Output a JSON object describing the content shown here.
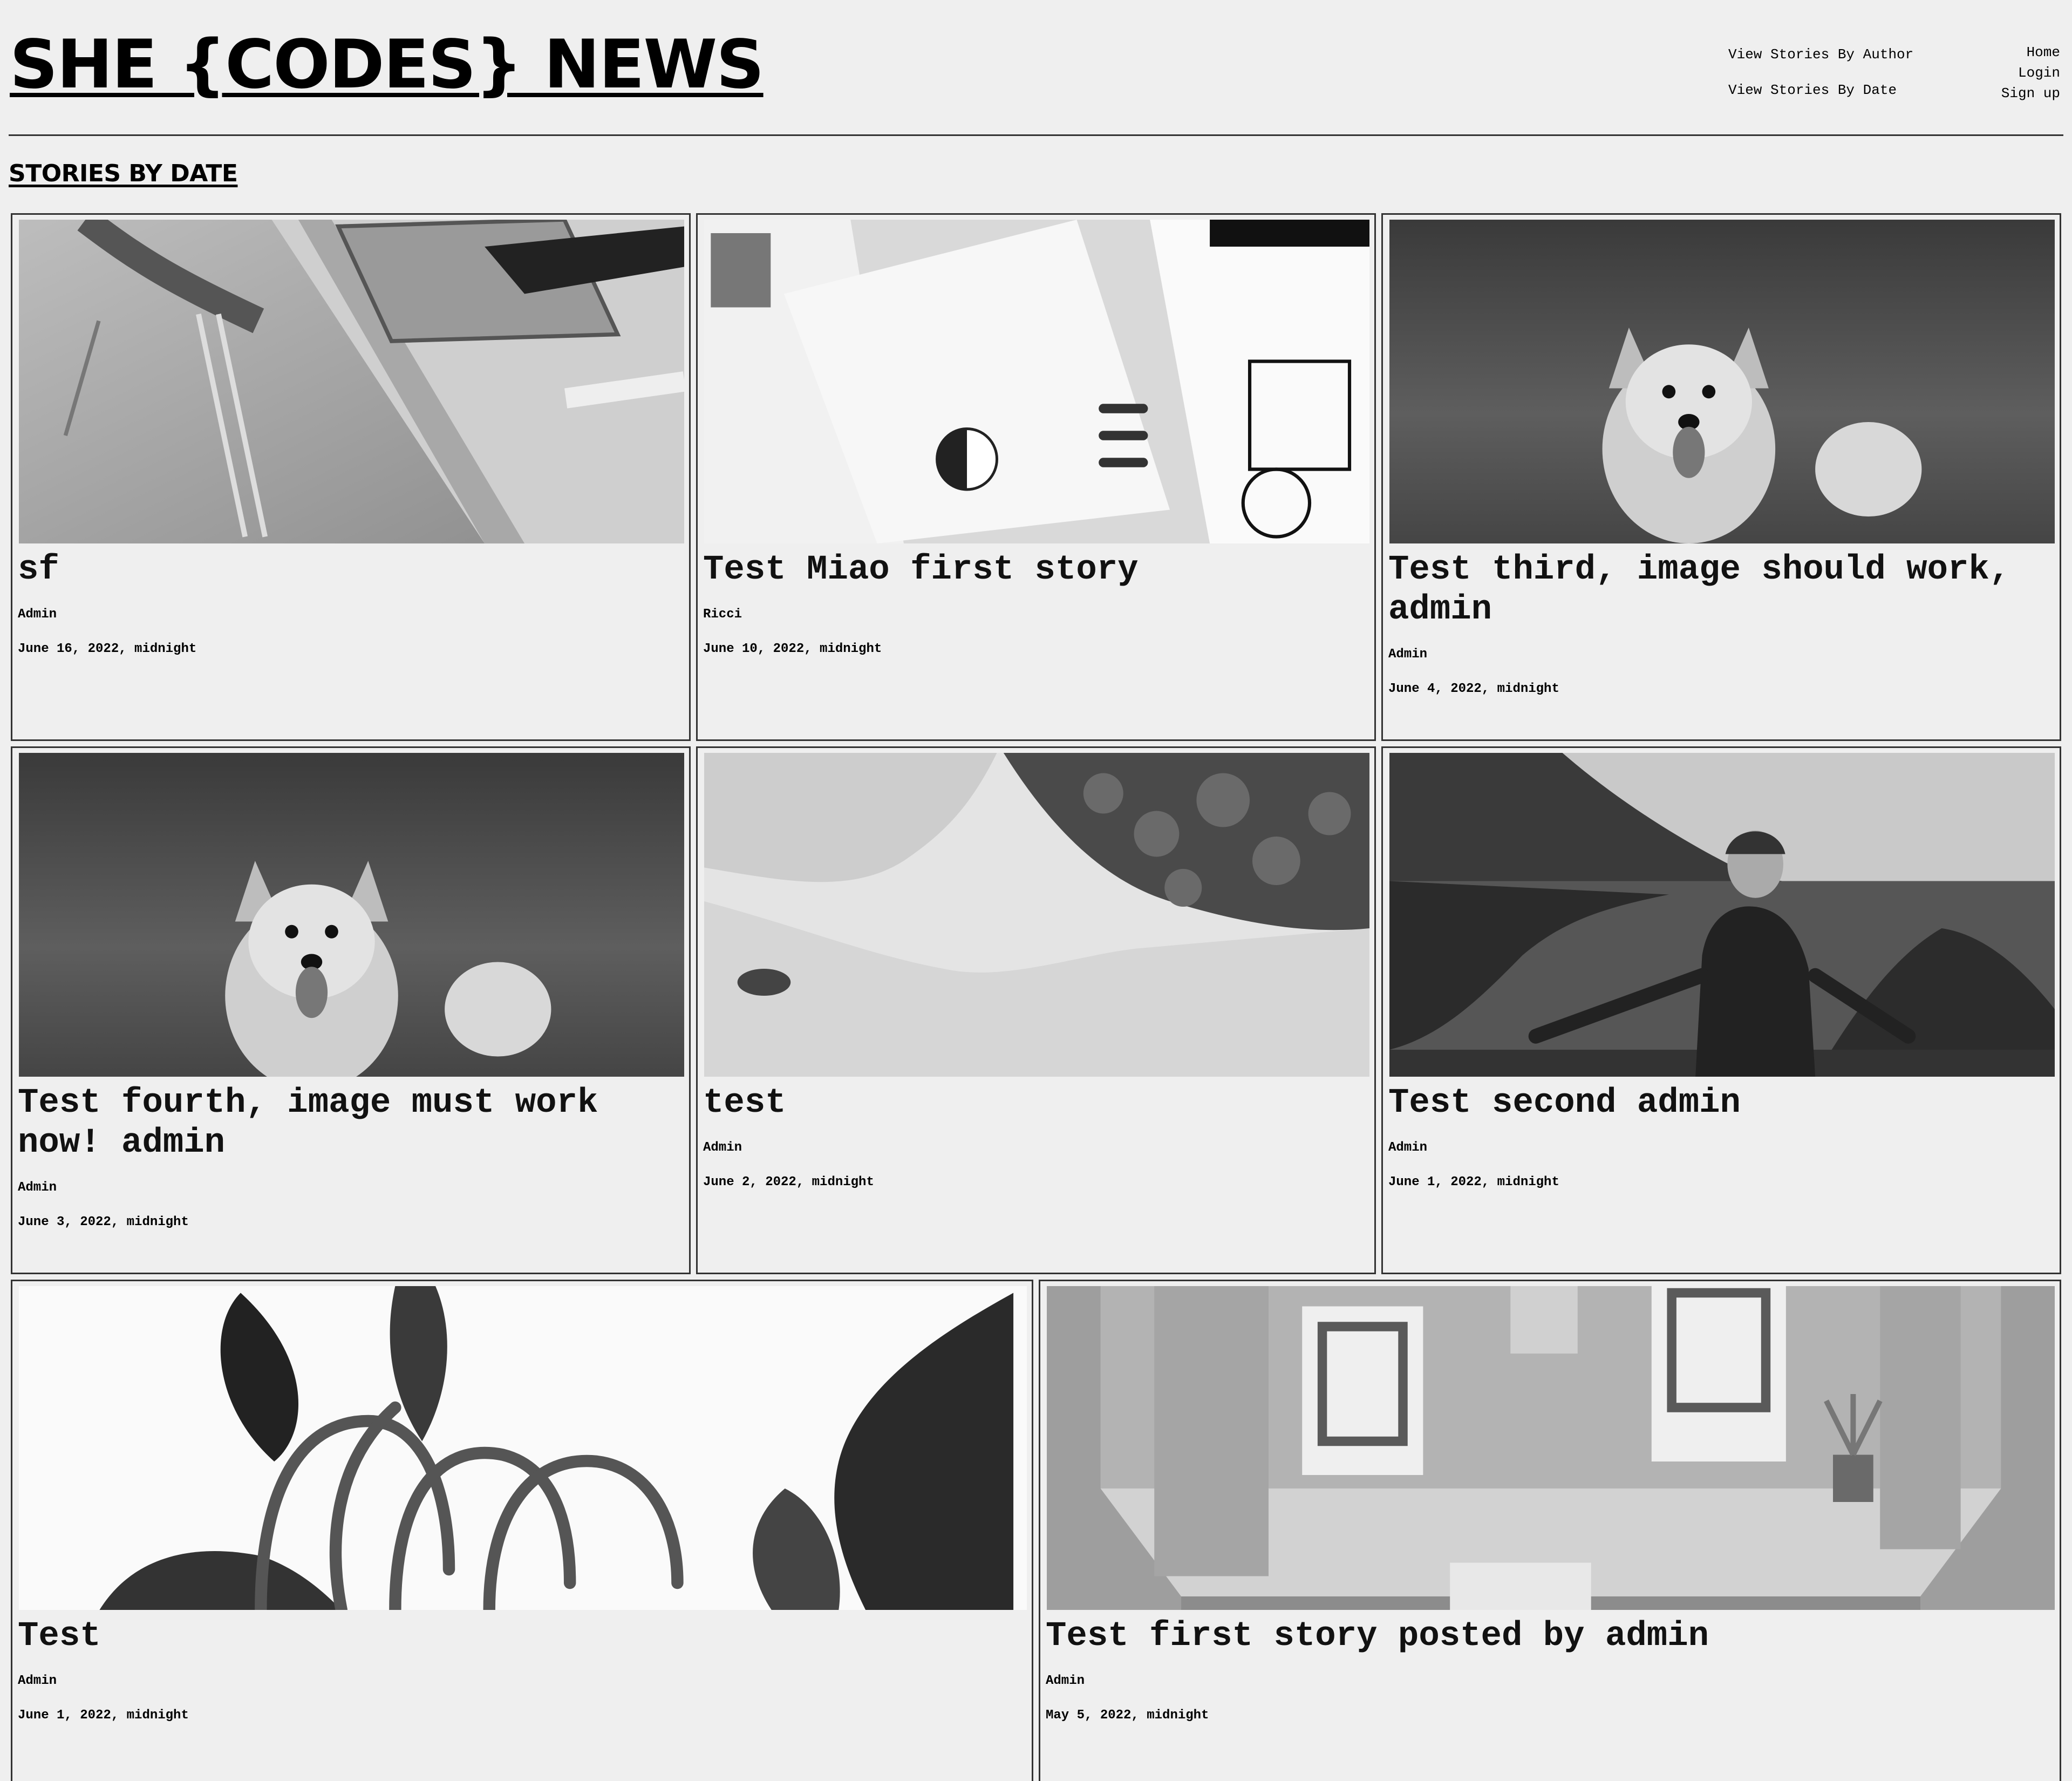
{
  "header": {
    "site_title": "SHE {CODES} NEWS",
    "nav_left": [
      "View Stories By Author",
      "View Stories By Date"
    ],
    "nav_right": [
      "Home",
      "Login",
      "Sign up"
    ]
  },
  "section": {
    "heading": "STORIES BY DATE"
  },
  "stories": [
    {
      "title": "sf",
      "author": "Admin",
      "date": "June 16, 2022, midnight",
      "image": "desk-with-ruler-and-notebook"
    },
    {
      "title": "Test Miao first story",
      "author": "Ricci",
      "date": "June 10, 2022, midnight",
      "image": "magazine-spreads"
    },
    {
      "title": "Test third, image should work, admin",
      "author": "Admin",
      "date": "June 4, 2022, midnight",
      "image": "corgi-in-grass"
    },
    {
      "title": "Test fourth, image must work now! admin",
      "author": "Admin",
      "date": "June 3, 2022, midnight",
      "image": "corgi-in-grass"
    },
    {
      "title": "test",
      "author": "Admin",
      "date": "June 2, 2022, midnight",
      "image": "aerial-beach-coastline"
    },
    {
      "title": "Test second admin",
      "author": "Admin",
      "date": "June 1, 2022, midnight",
      "image": "woman-at-coastal-overlook"
    },
    {
      "title": "Test",
      "author": "Admin",
      "date": "June 1, 2022, midnight",
      "image": "tropical-plant-leaves"
    },
    {
      "title": "Test first story posted by admin",
      "author": "Admin",
      "date": "May 5, 2022, midnight",
      "image": "isometric-gallery-room"
    }
  ]
}
